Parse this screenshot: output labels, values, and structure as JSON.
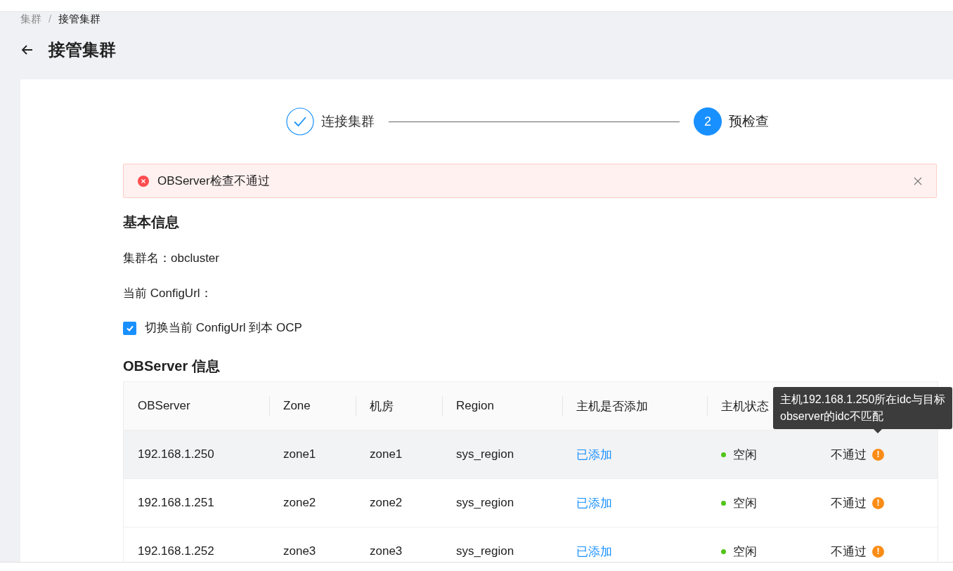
{
  "breadcrumb": {
    "separator": "/",
    "items": [
      {
        "label": "集群",
        "selected": false
      },
      {
        "label": "接管集群",
        "selected": true
      }
    ]
  },
  "page_title": "接管集群",
  "steps": [
    {
      "label": "连接集群",
      "done": true,
      "selected": false
    },
    {
      "label": "预检查",
      "number": "2",
      "done": false,
      "selected": true
    }
  ],
  "alert": {
    "message": "OBServer检查不通过"
  },
  "basic_info": {
    "title": "基本信息",
    "fields": [
      {
        "label": "集群名：",
        "value": "obcluster"
      },
      {
        "label": "当前 ConfigUrl："
      }
    ],
    "switch_checkbox": {
      "label": "切换当前 ConfigUrl 到本 OCP",
      "checked": true
    }
  },
  "observer_table": {
    "title": "OBServer 信息",
    "columns": [
      "OBServer",
      "Zone",
      "机房",
      "Region",
      "主机是否添加",
      "主机状态"
    ],
    "rows": [
      {
        "observer": "192.168.1.250",
        "zone": "zone1",
        "idc": "zone1",
        "region": "sys_region",
        "host_added": "已添加",
        "host_status": "空闲",
        "color": "#52c41a",
        "result": "不通过",
        "result_icon": "!",
        "tooltip": {
          "lines": [
            "主机192.168.1.250所在idc与目标",
            "observer的idc不匹配"
          ]
        }
      },
      {
        "observer": "192.168.1.251",
        "zone": "zone2",
        "idc": "zone2",
        "region": "sys_region",
        "host_added": "已添加",
        "host_status": "空闲",
        "color": "#52c41a",
        "result": "不通过",
        "result_icon": "!"
      },
      {
        "observer": "192.168.1.252",
        "zone": "zone3",
        "idc": "zone3",
        "region": "sys_region",
        "host_added": "已添加",
        "host_status": "空闲",
        "color": "#52c41a",
        "result": "不通过",
        "result_icon": "!"
      }
    ]
  }
}
